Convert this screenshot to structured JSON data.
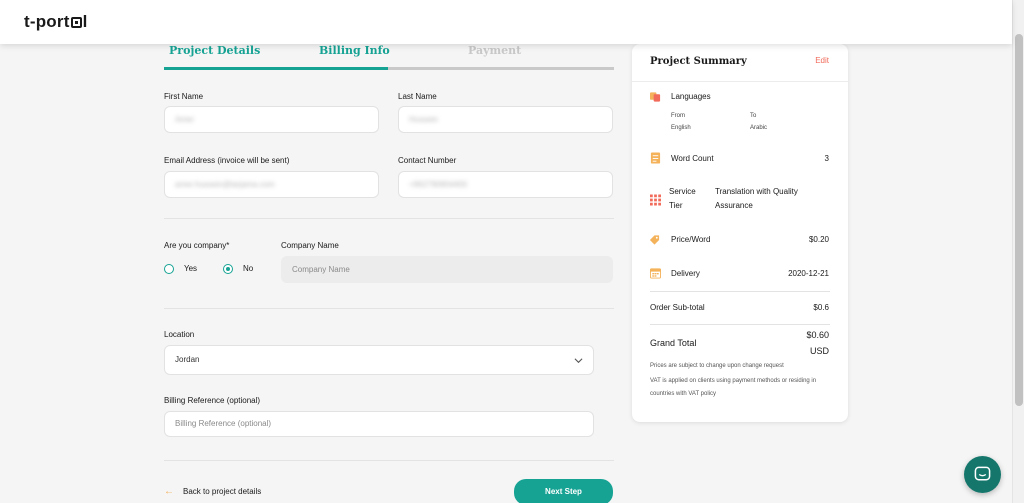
{
  "brand": {
    "logo": "t-portal",
    "logo_prefix": "t-port",
    "logo_suffix": "l"
  },
  "steps": [
    {
      "label": "Project Details",
      "state": "done"
    },
    {
      "label": "Billing Info",
      "state": "active"
    },
    {
      "label": "Payment",
      "state": "upcoming"
    }
  ],
  "form": {
    "first_name": {
      "label": "First Name",
      "value": "Amer"
    },
    "last_name": {
      "label": "Last Name",
      "value": "Hussein"
    },
    "email": {
      "label": "Email Address (invoice will be sent)",
      "value": "amer.hussein@tarjama.com"
    },
    "contact": {
      "label": "Contact Number",
      "value": "+962790804400"
    },
    "company_q": {
      "label": "Are you company*",
      "yes": "Yes",
      "no": "No",
      "selected": "No"
    },
    "company_name": {
      "label": "Company Name",
      "placeholder": "Company Name"
    },
    "location": {
      "label": "Location",
      "value": "Jordan"
    },
    "billing_ref": {
      "label": "Billing Reference (optional)",
      "placeholder": "Billing Reference (optional)"
    }
  },
  "footer": {
    "back": "Back to project details",
    "next": "Next Step"
  },
  "summary": {
    "title": "Project Summary",
    "edit": "Edit",
    "languages": {
      "label": "Languages",
      "from_label": "From",
      "from": "English",
      "to_label": "To",
      "to": "Arabic"
    },
    "word_count": {
      "label": "Word Count",
      "value": "3"
    },
    "service_tier": {
      "label_line1": "Service",
      "label_line2": "Tier",
      "value_line1": "Translation with Quality",
      "value_line2": "Assurance"
    },
    "price_word": {
      "label": "Price/Word",
      "value": "$0.20"
    },
    "delivery": {
      "label": "Delivery",
      "value": "2020-12-21"
    },
    "subtotal": {
      "label": "Order Sub-total",
      "value": "$0.6"
    },
    "grand_total": {
      "label": "Grand Total",
      "value": "$0.60",
      "currency": "USD"
    },
    "note1": "Prices are subject to change upon change request",
    "note2": "VAT is applied on clients using payment methods or residing in countries with VAT policy"
  },
  "colors": {
    "accent": "#16a394",
    "edit": "#f16a5a",
    "icon_orange": "#f4b25a",
    "chat": "#15776c"
  },
  "icons": [
    "languages-icon",
    "word-count-icon",
    "service-tier-icon",
    "price-tag-icon",
    "calendar-icon",
    "chevron-down-icon",
    "back-arrow-icon",
    "chat-icon"
  ]
}
